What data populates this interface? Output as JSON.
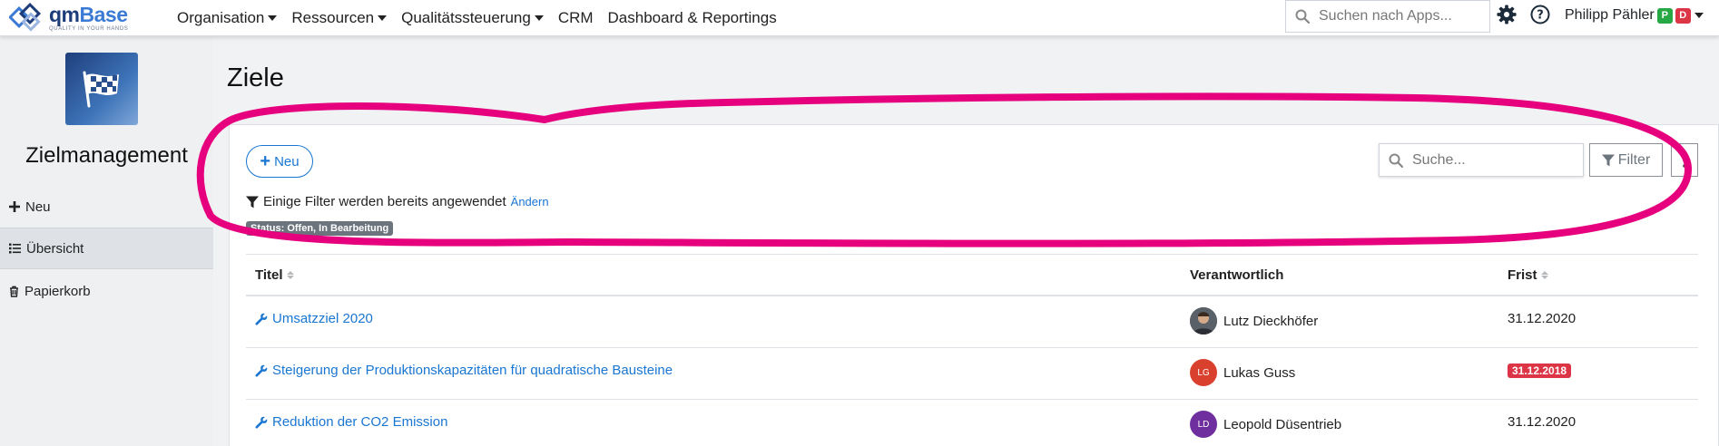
{
  "brand": {
    "name_part1": "qm",
    "name_part2": "Base",
    "tagline": "QUALITY IN YOUR HANDS"
  },
  "nav": {
    "items": [
      {
        "label": "Organisation",
        "dropdown": true
      },
      {
        "label": "Ressourcen",
        "dropdown": true
      },
      {
        "label": "Qualitätssteuerung",
        "dropdown": true
      },
      {
        "label": "CRM",
        "dropdown": false
      },
      {
        "label": "Dashboard & Reportings",
        "dropdown": false
      }
    ],
    "search_placeholder": "Suchen nach Apps...",
    "user_name": "Philipp Pähler",
    "user_badges": [
      "P",
      "D"
    ]
  },
  "sidebar": {
    "app_title": "Zielmanagement",
    "items": [
      {
        "label": "Neu",
        "icon": "plus-icon"
      },
      {
        "label": "Übersicht",
        "icon": "list-icon",
        "active": true
      },
      {
        "label": "Papierkorb",
        "icon": "trash-icon"
      }
    ]
  },
  "page": {
    "title": "Ziele"
  },
  "toolbar": {
    "new_label": "Neu",
    "search_placeholder": "Suche...",
    "filter_label": "Filter",
    "filter_notice": "Einige Filter werden bereits angewendet",
    "filter_change_link": "Ändern",
    "status_tag": "Status: Offen, In Bearbeitung"
  },
  "table": {
    "columns": [
      "Titel",
      "Verantwortlich",
      "Frist"
    ],
    "rows": [
      {
        "title": "Umsatzziel 2020",
        "responsible": "Lutz Dieckhöfer",
        "avatar": "photo",
        "due": "31.12.2020",
        "overdue": false
      },
      {
        "title": "Steigerung der Produktionskapazitäten für quadratische Bausteine",
        "responsible": "Lukas Guss",
        "avatar": "LG",
        "due": "31.12.2018",
        "overdue": true
      },
      {
        "title": "Reduktion der CO2 Emission",
        "responsible": "Leopold Düsentrieb",
        "avatar": "LD",
        "due": "31.12.2020",
        "overdue": false
      }
    ]
  },
  "colors": {
    "accent": "#1976d2",
    "highlight": "#e6007e",
    "danger": "#dc3545",
    "avatar_lg": "#d9402d",
    "avatar_ld": "#6f2f9e"
  }
}
